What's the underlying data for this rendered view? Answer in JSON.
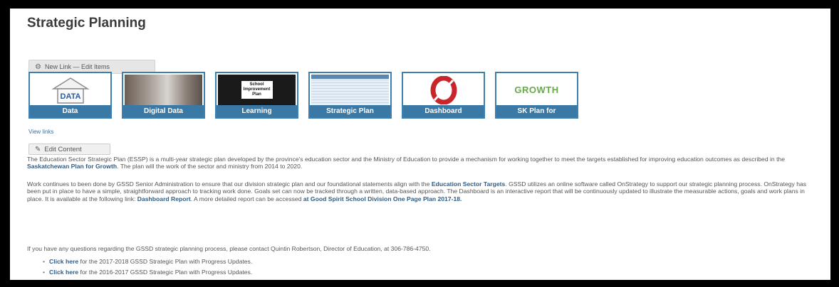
{
  "page": {
    "title": "Strategic Planning",
    "toolbar_label": "New Link — Edit Items",
    "tiles": [
      {
        "label": "Data",
        "thumb_text": "DATA"
      },
      {
        "label": "Digital Data",
        "thumb_text": ""
      },
      {
        "label": "Learning",
        "thumb_text": "School Improvement Plan"
      },
      {
        "label": "Strategic Plan",
        "thumb_text": ""
      },
      {
        "label": "Dashboard",
        "thumb_text": ""
      },
      {
        "label": "SK Plan for",
        "thumb_text": "GROWTH"
      }
    ],
    "view_links": "View links",
    "edit_content": "Edit Content",
    "para1": {
      "text1": "The Education Sector Strategic Plan (ESSP) is a multi-year strategic plan developed by the province's education sector and the Ministry of Education to provide a mechanism for working together to meet the targets established for improving education outcomes as described in the ",
      "link1": "Saskatchewan Plan for Growth",
      "text2": ". The plan will the work of the sector and ministry from 2014 to 2020."
    },
    "para2": {
      "text1": "Work continues to been done by GSSD Senior Administration to ensure that our division strategic plan and our foundational statements align with the ",
      "link1": "Education Sector Targets",
      "text2": ". GSSD utilizes an online software called OnStrategy to support our strategic planning process. OnStrategy has been put in place to have a simple, straightforward approach to tracking work done. Goals set can now be tracked through a written, data-based approach. The Dashboard is an interactive report that will be continuously updated to illustrate the measurable actions, goals and work plans in place. It is available at the following link: ",
      "link2": "Dashboard Report",
      "text3": ".  A more detailed report can be accessed ",
      "link3": "at Good Spirit School Division One Page Plan 2017-18."
    },
    "question": "If you have any questions regarding the GSSD strategic planning process, please contact Quintin Robertson, Director of Education, at 306-786-4750.",
    "bullets": [
      {
        "link": "Click here",
        "text": " for the 2017-2018 GSSD Strategic Plan with Progress Updates."
      },
      {
        "link": "Click here",
        "text": " for the 2016-2017 GSSD Strategic Plan with Progress Updates."
      }
    ]
  },
  "colors": {
    "tile_border": "#3d7fae",
    "tile_label_bg": "#3a79a6",
    "link": "#2f5d86",
    "dashboard_logo": "#c8262b",
    "growth_logo": "#6aa84f"
  }
}
